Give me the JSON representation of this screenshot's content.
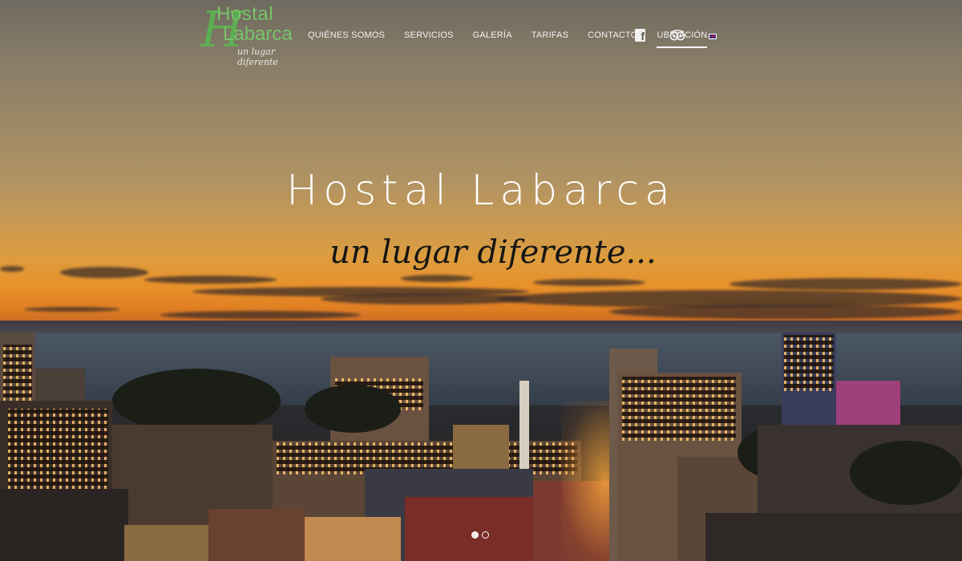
{
  "logo": {
    "line1": "Hostal",
    "line2": "Labarca",
    "h_letter": "H",
    "tagline": "un lugar diferente"
  },
  "menu": {
    "items": [
      {
        "label": "QUIÉNES SOMOS",
        "active": false
      },
      {
        "label": "SERVICIOS",
        "active": false
      },
      {
        "label": "GALERÍA",
        "active": false
      },
      {
        "label": "TARIFAS",
        "active": false
      },
      {
        "label": "CONTACTO",
        "active": false
      },
      {
        "label": "UBICACIÓN",
        "active": true
      }
    ],
    "facebook_icon": "facebook-icon",
    "tripadvisor_icon": "tripadvisor-icon",
    "language_icon": "uk-flag-icon"
  },
  "hero": {
    "title": "Hostal Labarca",
    "subtitle": "un lugar diferente..."
  },
  "slider": {
    "slide_count": 2,
    "active_index": 1
  },
  "colors": {
    "logo_green": "#79c26a",
    "nav_text": "#f2f2f2",
    "title_text": "#ffffff",
    "subtitle_text": "#151515"
  }
}
